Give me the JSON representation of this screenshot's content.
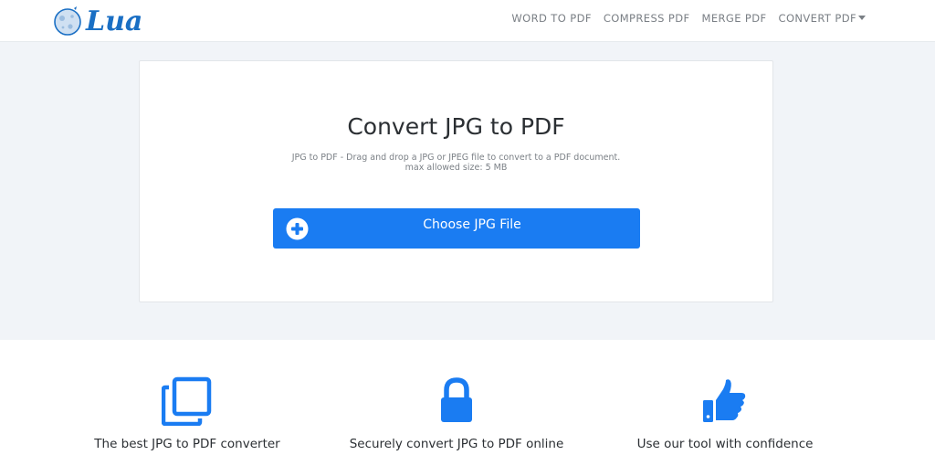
{
  "brand": {
    "name": "Lua",
    "logo_icon": "moon-icon"
  },
  "nav": {
    "items": [
      {
        "label": "WORD TO PDF"
      },
      {
        "label": "COMPRESS PDF"
      },
      {
        "label": "MERGE PDF"
      },
      {
        "label": "CONVERT PDF",
        "dropdown": true
      }
    ]
  },
  "converter": {
    "title": "Convert JPG to PDF",
    "description": "JPG to PDF - Drag and drop a JPG or JPEG file to convert to a PDF document.",
    "limit": "max allowed size: 5 MB",
    "button_label": "Choose JPG File",
    "button_icon": "plus-circle-icon"
  },
  "features": [
    {
      "icon": "copy-icon",
      "title": "The best JPG to PDF converter"
    },
    {
      "icon": "lock-icon",
      "title": "Securely convert JPG to PDF online"
    },
    {
      "icon": "thumbs-up-icon",
      "title": "Use our tool with confidence"
    }
  ],
  "colors": {
    "accent": "#1a7cf2",
    "hero_bg": "#f1f4f8",
    "brand": "#1a6fc4",
    "nav_text": "#7a7f85"
  }
}
